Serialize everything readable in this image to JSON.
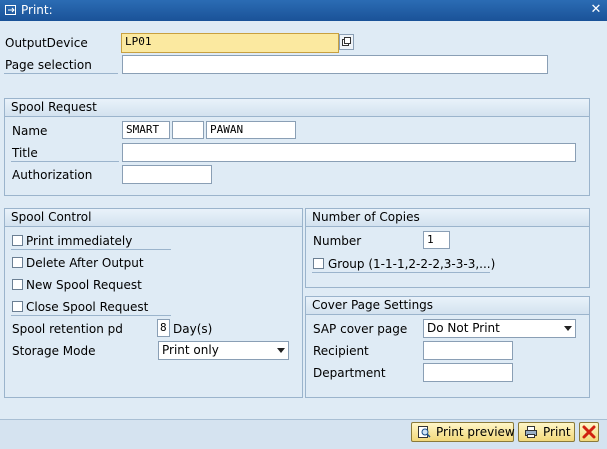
{
  "window": {
    "title": "Print:",
    "close": "✕"
  },
  "output": {
    "device_label": "OutputDevice",
    "device_value": "LP01",
    "page_selection_label": "Page selection",
    "page_selection_value": ""
  },
  "spool_request": {
    "title": "Spool Request",
    "name_label": "Name",
    "name_part1": "SMART",
    "name_part2": "",
    "name_part3": "PAWAN",
    "title_label": "Title",
    "title_value": "",
    "authorization_label": "Authorization",
    "authorization_value": ""
  },
  "spool_control": {
    "title": "Spool Control",
    "print_immediately": "Print immediately",
    "delete_after_output": "Delete After Output",
    "new_spool_request": "New Spool Request",
    "close_spool_request": "Close Spool Request",
    "retention_label": "Spool retention pd",
    "retention_value": "8",
    "retention_unit": "Day(s)",
    "storage_mode_label": "Storage Mode",
    "storage_mode_value": "Print only"
  },
  "copies": {
    "title": "Number of Copies",
    "number_label": "Number",
    "number_value": "1",
    "group_label": "Group (1-1-1,2-2-2,3-3-3,...)"
  },
  "cover_page": {
    "title": "Cover Page Settings",
    "sap_cover_label": "SAP cover page",
    "sap_cover_value": "Do Not Print",
    "recipient_label": "Recipient",
    "recipient_value": "",
    "department_label": "Department",
    "department_value": ""
  },
  "footer": {
    "print_preview": "Print preview",
    "print": "Print"
  },
  "colors": {
    "titlebar": "#1e5fa8",
    "background": "#dfebf5",
    "required_field": "#fbe9a0",
    "cancel_red": "#d02010"
  }
}
